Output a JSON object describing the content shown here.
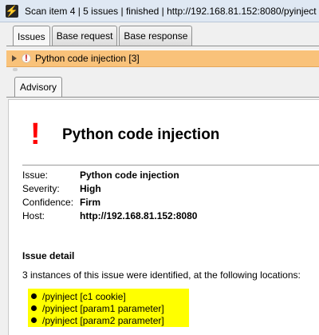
{
  "window": {
    "title": "Scan item 4 | 5 issues | finished | http://192.168.81.152:8080/pyinject",
    "icon": "burp-logo-icon"
  },
  "tabs": [
    {
      "label": "Issues",
      "active": true
    },
    {
      "label": "Base request",
      "active": false
    },
    {
      "label": "Base response",
      "active": false
    }
  ],
  "issue_row": {
    "label": "Python code injection [3]",
    "color": "#f9c27a"
  },
  "subtabs": [
    {
      "label": "Advisory",
      "active": true
    }
  ],
  "advisory": {
    "title": "Python code injection",
    "meta": [
      {
        "label": "Issue:",
        "value": "Python code injection"
      },
      {
        "label": "Severity:",
        "value": "High"
      },
      {
        "label": "Confidence:",
        "value": "Firm"
      },
      {
        "label": "Host:",
        "value": "http://192.168.81.152:8080"
      }
    ],
    "detail_heading": "Issue detail",
    "detail_text": "3 instances of this issue were identified, at the following locations:",
    "locations": [
      "/pyinject [c1 cookie]",
      "/pyinject [param1 parameter]",
      "/pyinject [param2 parameter]"
    ],
    "severity_color": "#ff0000",
    "highlight_color": "#ffff00"
  }
}
